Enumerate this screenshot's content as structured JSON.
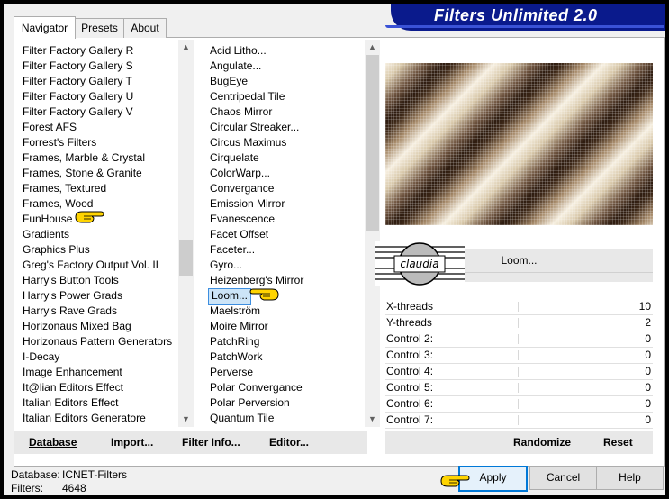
{
  "window": {
    "title": "Filters Unlimited 2.0"
  },
  "tabs": [
    {
      "label": "Navigator"
    },
    {
      "label": "Presets"
    },
    {
      "label": "About"
    }
  ],
  "categories": [
    "Filter Factory Gallery R",
    "Filter Factory Gallery S",
    "Filter Factory Gallery T",
    "Filter Factory Gallery U",
    "Filter Factory Gallery V",
    "Forest AFS",
    "Forrest's Filters",
    "Frames, Marble & Crystal",
    "Frames, Stone & Granite",
    "Frames, Textured",
    "Frames, Wood",
    "FunHouse",
    "Gradients",
    "Graphics Plus",
    "Greg's Factory Output Vol. II",
    "Harry's Button Tools",
    "Harry's Power Grads",
    "Harry's Rave Grads",
    "Horizonaus Mixed Bag",
    "Horizonaus Pattern Generators",
    "I-Decay",
    "Image Enhancement",
    "It@lian Editors Effect",
    "Italian Editors Effect",
    "Italian Editors Generatore"
  ],
  "filters": [
    "Acid Litho...",
    "Angulate...",
    "BugEye",
    "Centripedal Tile",
    "Chaos Mirror",
    "Circular Streaker...",
    "Circus Maximus",
    "Cirquelate",
    "ColorWarp...",
    "Convergance",
    "Emission Mirror",
    "Evanescence",
    "Facet Offset",
    "Faceter...",
    "Gyro...",
    "Heizenberg's Mirror",
    "Loom...",
    "Maelström",
    "Moire Mirror",
    "PatchRing",
    "PatchWork",
    "Perverse",
    "Polar Convergance",
    "Polar Perversion",
    "Quantum Tile"
  ],
  "selected_category": "FunHouse",
  "selected_filter": "Loom...",
  "filter_name": "Loom...",
  "watermark": "claudia",
  "controls": [
    {
      "label": "X-threads",
      "value": "10"
    },
    {
      "label": "Y-threads",
      "value": "2"
    },
    {
      "label": "Control 2:",
      "value": "0"
    },
    {
      "label": "Control 3:",
      "value": "0"
    },
    {
      "label": "Control 4:",
      "value": "0"
    },
    {
      "label": "Control 5:",
      "value": "0"
    },
    {
      "label": "Control 6:",
      "value": "0"
    },
    {
      "label": "Control 7:",
      "value": "0"
    }
  ],
  "toolbar": {
    "database": "Database",
    "import": "Import...",
    "filter_info": "Filter Info...",
    "editor": "Editor...",
    "randomize": "Randomize",
    "reset": "Reset"
  },
  "status": {
    "database_label": "Database:",
    "database_value": "ICNET-Filters",
    "filters_label": "Filters:",
    "filters_value": "4648"
  },
  "buttons": {
    "apply": "Apply",
    "cancel": "Cancel",
    "help": "Help"
  },
  "colors": {
    "title_band": "#0a1a8c",
    "selection": "#cce4f7",
    "accent": "#0078d7"
  }
}
